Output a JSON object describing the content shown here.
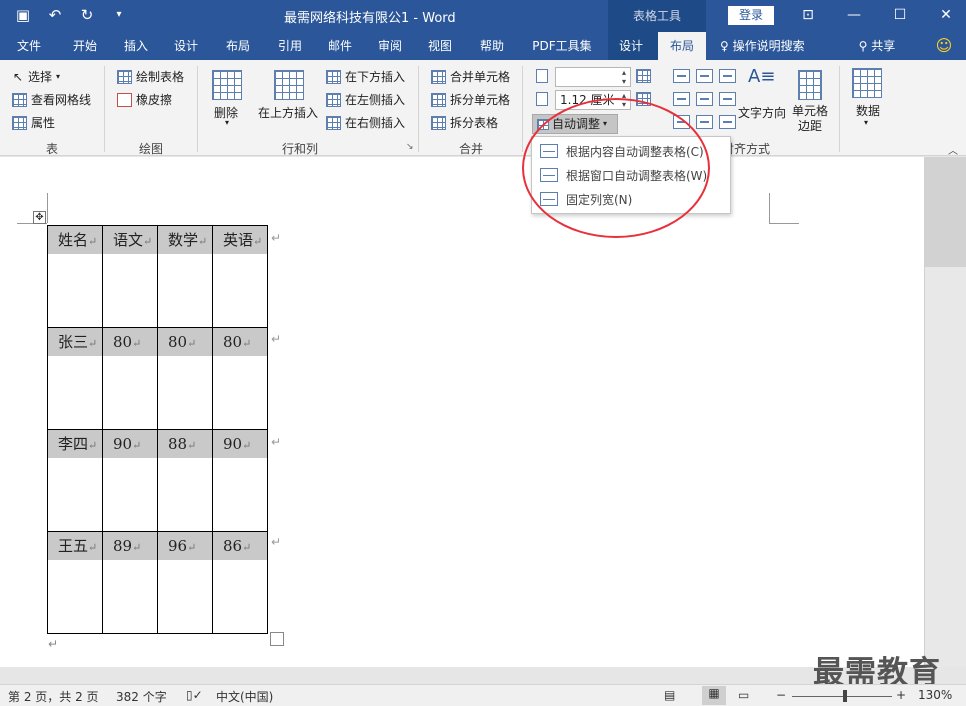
{
  "titlebar": {
    "doc_title": "最需网络科技有限公1  -  Word",
    "context_tools": "表格工具",
    "login": "登录"
  },
  "tabs": [
    "文件",
    "开始",
    "插入",
    "设计",
    "布局",
    "引用",
    "邮件",
    "审阅",
    "视图",
    "帮助",
    "PDF工具集",
    "设计",
    "布局"
  ],
  "tell_me": "操作说明搜索",
  "share": "共享",
  "ribbon": {
    "table_group": {
      "select": "选择",
      "view_gridlines": "查看网格线",
      "properties": "属性",
      "label": "表"
    },
    "draw_group": {
      "draw_table": "绘制表格",
      "eraser": "橡皮擦",
      "label": "绘图"
    },
    "rows_cols_group": {
      "delete": "删除",
      "insert_above": "在上方插入",
      "insert_below": "在下方插入",
      "insert_left": "在左侧插入",
      "insert_right": "在右侧插入",
      "label": "行和列"
    },
    "merge_group": {
      "merge_cells": "合并单元格",
      "split_cells": "拆分单元格",
      "split_table": "拆分表格",
      "label": "合并"
    },
    "cell_size": {
      "height_value": "",
      "width_value": "1.12 厘米",
      "autofit": "自动调整"
    },
    "alignment": {
      "text_direction": "文字方向",
      "cell_margins": "单元格边距",
      "label": "对齐方式"
    },
    "data": {
      "label": "数据"
    }
  },
  "autofit_menu": [
    {
      "label": "根据内容自动调整表格(C)"
    },
    {
      "label": "根据窗口自动调整表格(W)"
    },
    {
      "label": "固定列宽(N)"
    }
  ],
  "table": {
    "rows": [
      [
        "姓名",
        "语文",
        "数学",
        "英语"
      ],
      [
        "张三",
        "80",
        "80",
        "80"
      ],
      [
        "李四",
        "90",
        "88",
        "90"
      ],
      [
        "王五",
        "89",
        "96",
        "86"
      ]
    ]
  },
  "marks": {
    "cell_end": "↵",
    "row_end": "↵",
    "para_end": "↵"
  },
  "watermark": "最需教育",
  "status": {
    "page": "第 2 页，共 2 页",
    "words": "382 个字",
    "language": "中文(中国)",
    "zoom": "130%"
  },
  "colors": {
    "title_blue": "#2b579a",
    "context_blue": "#1e4a87",
    "annotation_red": "#e8303a"
  }
}
